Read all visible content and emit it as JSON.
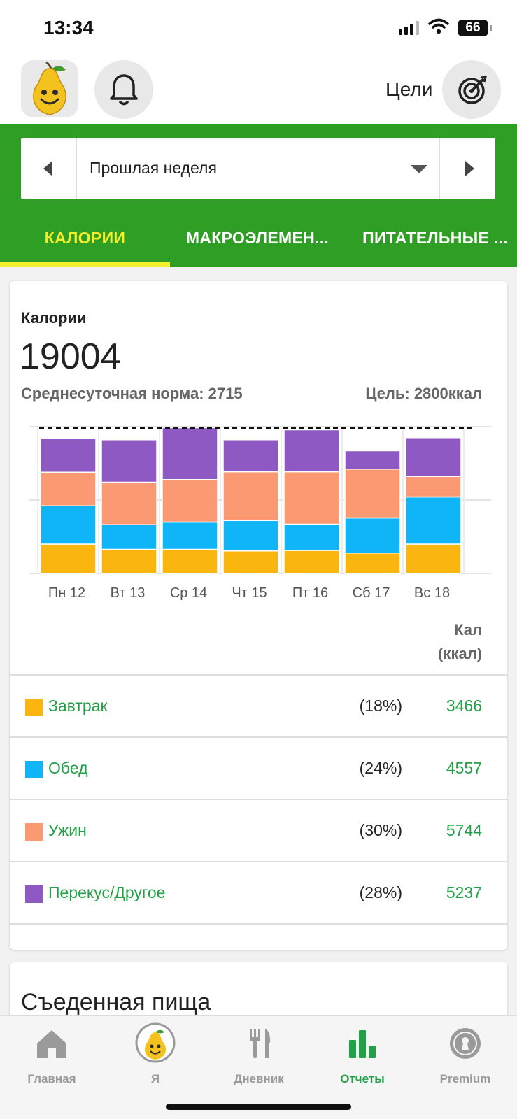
{
  "status_bar": {
    "time": "13:34",
    "battery": "66"
  },
  "header": {
    "goals_label": "Цели"
  },
  "period": {
    "label": "Прошлая неделя"
  },
  "tabs": [
    {
      "label": "КАЛОРИИ",
      "active": true
    },
    {
      "label": "МАКРОЭЛЕМЕН...",
      "active": false
    },
    {
      "label": "ПИТАТЕЛЬНЫЕ ...",
      "active": false
    }
  ],
  "summary": {
    "title": "Калории",
    "total": "19004",
    "average": "Среднесуточная норма: 2715",
    "goal": "Цель: 2800ккал",
    "column_header_line1": "Кал",
    "column_header_line2": "(ккал)"
  },
  "colors": {
    "breakfast": "#fbb50f",
    "lunch": "#0fb5f6",
    "dinner": "#fb9a72",
    "snack": "#8e59c2",
    "green": "#2f9e25",
    "accent_yellow": "#f3ef2b",
    "text_green": "#23a047"
  },
  "meals": [
    {
      "name": "Завтрак",
      "pct": "(18%)",
      "value": "3466",
      "color": "#fbb50f"
    },
    {
      "name": "Обед",
      "pct": "(24%)",
      "value": "4557",
      "color": "#0fb5f6"
    },
    {
      "name": "Ужин",
      "pct": "(30%)",
      "value": "5744",
      "color": "#fb9a72"
    },
    {
      "name": "Перекус/Другое",
      "pct": "(28%)",
      "value": "5237",
      "color": "#8e59c2"
    }
  ],
  "chart_data": {
    "type": "bar",
    "stacked": true,
    "categories": [
      "Пн 12",
      "Вт 13",
      "Ср 14",
      "Чт 15",
      "Пт 16",
      "Сб 17",
      "Вс 18"
    ],
    "series": [
      {
        "name": "Завтрак",
        "color": "#fbb50f",
        "values": [
          560,
          460,
          460,
          430,
          440,
          390,
          560
        ]
      },
      {
        "name": "Обед",
        "color": "#0fb5f6",
        "values": [
          730,
          470,
          520,
          580,
          500,
          670,
          900
        ]
      },
      {
        "name": "Ужин",
        "color": "#fb9a72",
        "values": [
          640,
          810,
          810,
          930,
          1000,
          930,
          390
        ]
      },
      {
        "name": "Перекус/Другое",
        "color": "#8e59c2",
        "values": [
          650,
          810,
          990,
          610,
          800,
          350,
          740
        ]
      }
    ],
    "goal_line": 2800,
    "ylim": [
      0,
      2800
    ],
    "grid": true
  },
  "second_card": {
    "title": "Съеденная пища"
  },
  "bottom_nav": [
    {
      "label": "Главная",
      "icon": "home-icon",
      "active": false
    },
    {
      "label": "Я",
      "icon": "pear-avatar-icon",
      "active": false
    },
    {
      "label": "Дневник",
      "icon": "fork-knife-icon",
      "active": false
    },
    {
      "label": "Отчеты",
      "icon": "bar-chart-icon",
      "active": true
    },
    {
      "label": "Premium",
      "icon": "premium-badge-icon",
      "active": false
    }
  ]
}
